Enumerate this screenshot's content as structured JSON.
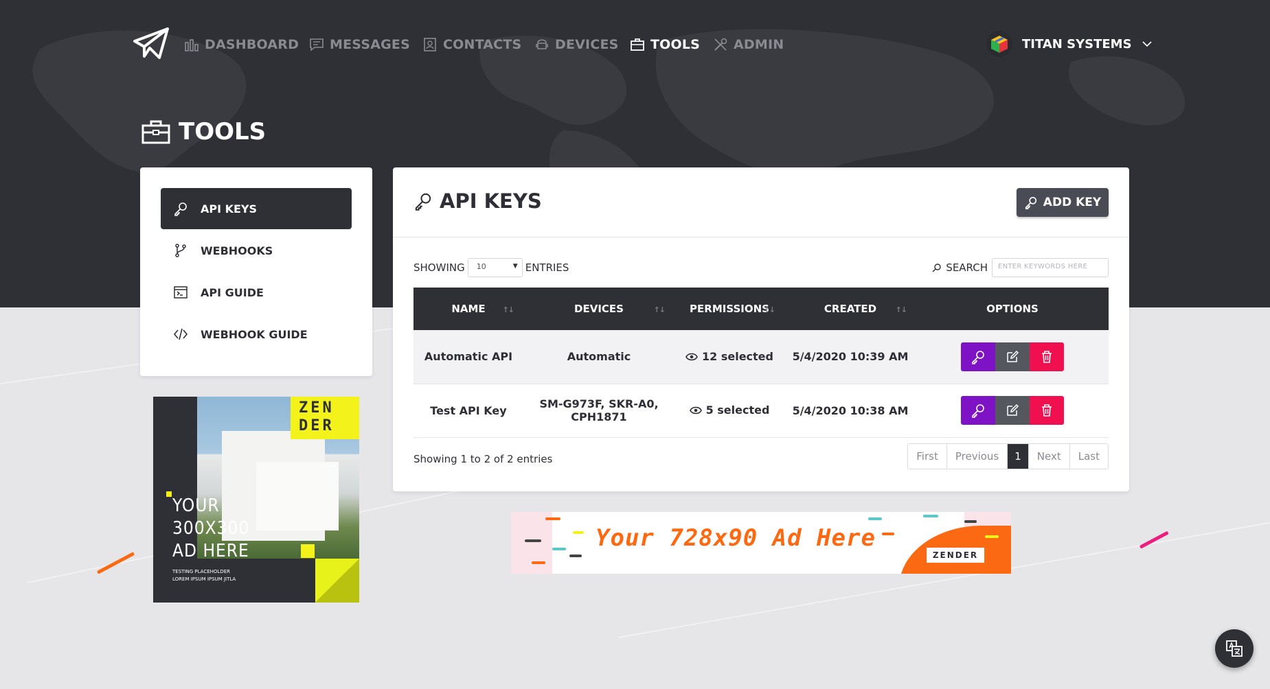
{
  "nav": {
    "items": [
      {
        "label": "DASHBOARD",
        "icon": "bar-chart-icon"
      },
      {
        "label": "MESSAGES",
        "icon": "message-icon"
      },
      {
        "label": "CONTACTS",
        "icon": "contact-card-icon"
      },
      {
        "label": "DEVICES",
        "icon": "android-icon"
      },
      {
        "label": "TOOLS",
        "icon": "toolbox-icon",
        "active": true
      },
      {
        "label": "ADMIN",
        "icon": "tools-icon"
      }
    ],
    "account": "TITAN SYSTEMS"
  },
  "page": {
    "title": "TOOLS"
  },
  "sidebar": {
    "items": [
      {
        "label": "API KEYS",
        "icon": "key-icon",
        "active": true
      },
      {
        "label": "WEBHOOKS",
        "icon": "branch-icon"
      },
      {
        "label": "API GUIDE",
        "icon": "terminal-icon"
      },
      {
        "label": "WEBHOOK GUIDE",
        "icon": "code-icon"
      }
    ]
  },
  "ad_square": {
    "brand_line1": "ZEN",
    "brand_line2": "DER",
    "line1": "YOUR",
    "line2": "300X300",
    "line3": "AD HERE",
    "small1": "TESTING PLACEHOLDER",
    "small2": "LOREM IPSUM IPSUM JITLA"
  },
  "card": {
    "title": "API KEYS",
    "add_button": "ADD KEY",
    "showing_label": "SHOWING",
    "entries_value": "10",
    "entries_label": "ENTRIES",
    "search_label": "SEARCH",
    "search_placeholder": "ENTER KEYWORDS HERE",
    "columns": [
      "NAME",
      "DEVICES",
      "PERMISSIONS",
      "CREATED",
      "OPTIONS"
    ],
    "rows": [
      {
        "name": "Automatic API",
        "devices": "Automatic",
        "permissions": "12 selected",
        "created": "5/4/2020 10:39 AM"
      },
      {
        "name": "Test API Key",
        "devices": "SM-G973F, SKR-A0, CPH1871",
        "permissions": "5 selected",
        "created": "5/4/2020 10:38 AM"
      }
    ],
    "info": "Showing 1 to 2 of 2 entries",
    "pager": {
      "first": "First",
      "previous": "Previous",
      "current": "1",
      "next": "Next",
      "last": "Last"
    }
  },
  "banner": {
    "text": "Your 728x90 Ad Here",
    "brand": "ZENDER"
  },
  "colors": {
    "dark": "#2f3036",
    "purple": "#7d13c4",
    "red": "#f0104f",
    "orange": "#fb6a12",
    "yellow": "#f3f31b"
  }
}
